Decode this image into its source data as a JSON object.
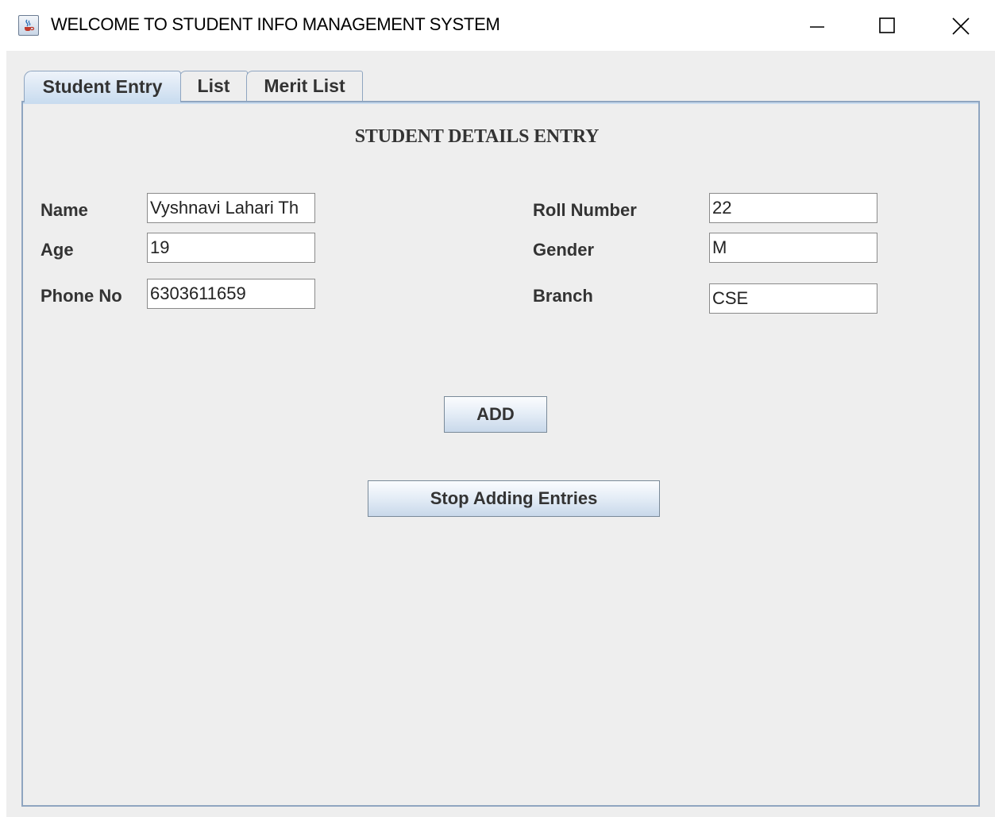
{
  "window": {
    "title": "WELCOME TO STUDENT INFO MANAGEMENT SYSTEM",
    "icon": "java-cup-icon",
    "controls": [
      "minimize-icon",
      "maximize-icon",
      "close-icon"
    ]
  },
  "tabs": [
    {
      "label": "Student Entry",
      "selected": true
    },
    {
      "label": "List",
      "selected": false
    },
    {
      "label": "Merit List",
      "selected": false
    }
  ],
  "form": {
    "heading": "STUDENT DETAILS ENTRY",
    "name_label": "Name",
    "name_value": "Vyshnavi Lahari Th",
    "age_label": "Age",
    "age_value": "19",
    "phone_label": "Phone No",
    "phone_value": "6303611659",
    "roll_label": "Roll Number",
    "roll_value": "22",
    "gender_label": "Gender",
    "gender_value": "M",
    "branch_label": "Branch",
    "branch_value": "CSE"
  },
  "buttons": {
    "add_label": "ADD",
    "stop_label": "Stop Adding Entries"
  },
  "colors": {
    "panel_background": "#eeeeee",
    "tab_border": "#8fa5c0",
    "selected_tab": "#c9dcef",
    "text": "#333333"
  }
}
